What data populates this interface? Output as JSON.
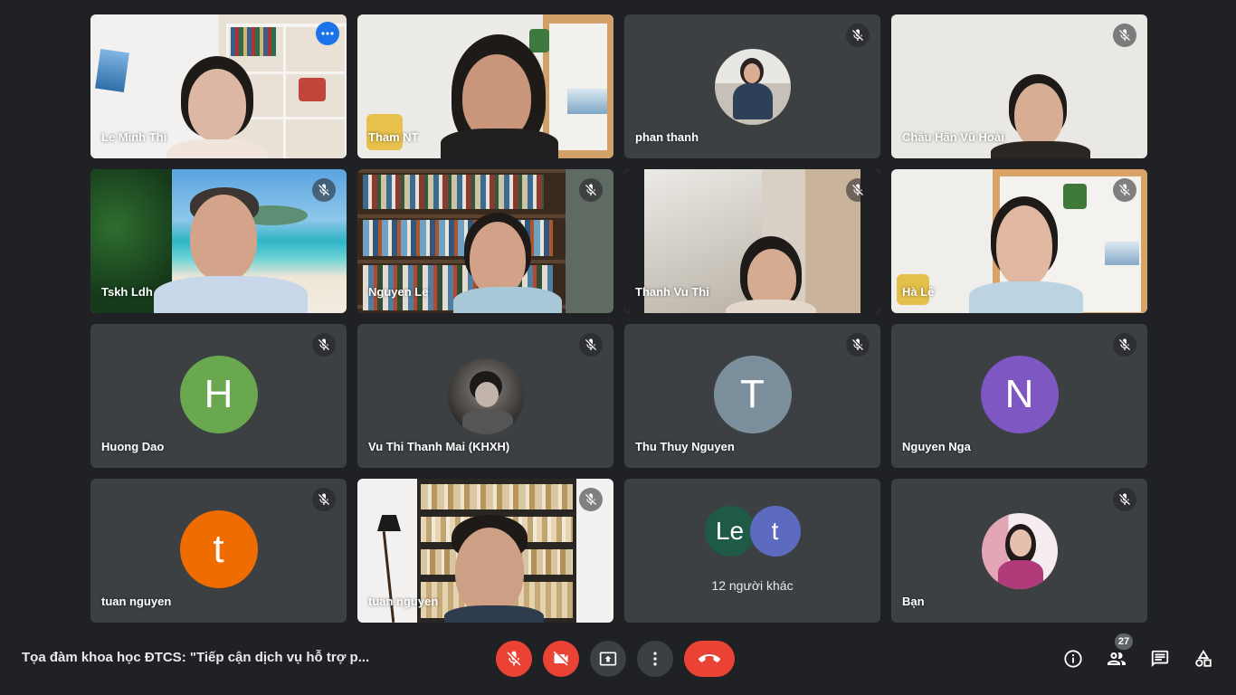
{
  "participants": [
    {
      "name": "Le Minh Thi",
      "type": "video",
      "active": true
    },
    {
      "name": "Tham NT",
      "type": "video"
    },
    {
      "name": "phan thanh",
      "type": "photo",
      "muted": true
    },
    {
      "name": "Châu Hân Vũ Hoài",
      "type": "video",
      "muted": true
    },
    {
      "name": "Tskh Ldh",
      "type": "video",
      "muted": true
    },
    {
      "name": "Nguyen Le",
      "type": "video",
      "muted": true
    },
    {
      "name": "Thanh Vu Thi",
      "type": "video",
      "muted": true
    },
    {
      "name": "Hà Lê",
      "type": "video",
      "muted": true
    },
    {
      "name": "Huong Dao",
      "type": "letter",
      "letter": "H",
      "color": "#6aa84f",
      "muted": true
    },
    {
      "name": "Vu Thi Thanh Mai (KHXH)",
      "type": "photo",
      "muted": true
    },
    {
      "name": "Thu Thuy Nguyen",
      "type": "letter",
      "letter": "T",
      "color": "#7b8f9c",
      "muted": true
    },
    {
      "name": "Nguyen Nga",
      "type": "letter",
      "letter": "N",
      "color": "#7e57c2",
      "muted": true
    },
    {
      "name": "tuan nguyen",
      "type": "letter",
      "letter": "t",
      "color": "#ef6c00",
      "muted": true
    },
    {
      "name": "tuan nguyen",
      "type": "video",
      "muted": true
    },
    {
      "name": "",
      "type": "others"
    },
    {
      "name": "Bạn",
      "type": "photo",
      "muted": true
    }
  ],
  "others_tile": {
    "avatars": [
      {
        "letter": "Le",
        "color": "#1e5a45"
      },
      {
        "letter": "t",
        "color": "#5c6bc0"
      }
    ],
    "label": "12 người khác"
  },
  "meeting": {
    "title": "Tọa đàm khoa học ĐTCS: \"Tiếp cận dịch vụ hỗ trợ p..."
  },
  "toolbar": {
    "participant_count": "27"
  },
  "colors": {
    "background": "#202124",
    "tile": "#3c4043",
    "end_call": "#ea4335",
    "active_border": "#8ab4f8"
  }
}
